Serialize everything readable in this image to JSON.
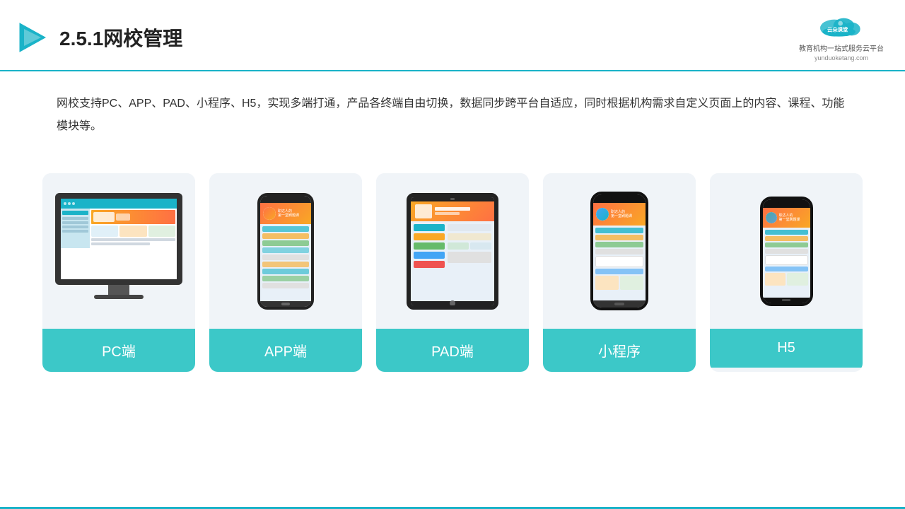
{
  "header": {
    "title": "2.5.1网校管理",
    "logo_main": "云朵课堂",
    "logo_url": "yunduoketang.com",
    "logo_sub": "教育机构一站\n式服务云平台"
  },
  "description": {
    "text": "网校支持PC、APP、PAD、小程序、H5，实现多端打通，产品各终端自由切换，数据同步跨平台自适应，同时根据机构需求自定义页面上的内容、课程、功能模块等。"
  },
  "cards": [
    {
      "id": "pc",
      "label": "PC端"
    },
    {
      "id": "app",
      "label": "APP端"
    },
    {
      "id": "pad",
      "label": "PAD端"
    },
    {
      "id": "miniprogram",
      "label": "小程序"
    },
    {
      "id": "h5",
      "label": "H5"
    }
  ],
  "accent_color": "#3cc8c8"
}
